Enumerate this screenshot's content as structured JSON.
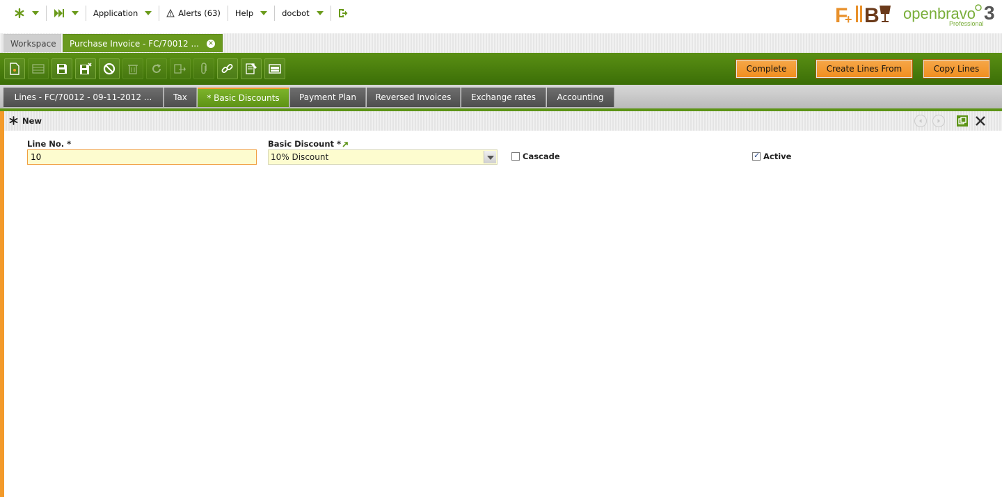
{
  "nav": {
    "application": "Application",
    "alerts": "Alerts (63)",
    "help": "Help",
    "user": "docbot"
  },
  "logos": {
    "fb_text": "F+B",
    "openbravo_text": "openbravo",
    "openbravo_edition": "Professional",
    "openbravo_version": "3"
  },
  "window_tabs": {
    "workspace": "Workspace",
    "invoice": "Purchase Invoice - FC/70012 ..."
  },
  "toolbar": {
    "complete": "Complete",
    "create_lines_from": "Create Lines From",
    "copy_lines": "Copy Lines"
  },
  "child_tabs": [
    "Lines - FC/70012 - 09-11-2012 ...",
    "Tax",
    "* Basic Discounts",
    "Payment Plan",
    "Reversed Invoices",
    "Exchange rates",
    "Accounting"
  ],
  "form": {
    "status": "New",
    "line_no_label": "Line No. *",
    "line_no_value": "10",
    "basic_discount_label": "Basic Discount *",
    "basic_discount_value": "10% Discount",
    "cascade_label": "Cascade",
    "cascade_checked": false,
    "active_label": "Active",
    "active_checked": true
  },
  "colors": {
    "accent_green": "#5a8f14",
    "accent_orange": "#f39a2a"
  }
}
